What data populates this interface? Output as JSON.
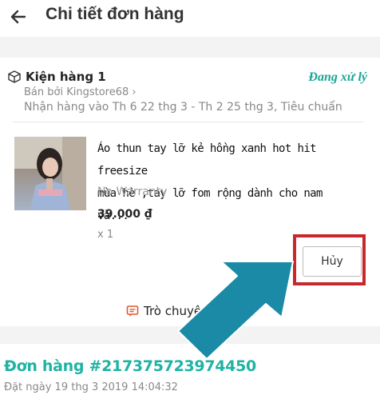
{
  "header": {
    "title": "Chi tiết đơn hàng",
    "back_icon": "arrow-left-icon"
  },
  "package": {
    "label": "Kiện hàng 1",
    "status": "Đang xử lý",
    "seller": "Bán bởi Kingstore68",
    "delivery": "Nhận hàng vào Th 6 22 thg 3 - Th 2 25 thg 3, Tiêu chuẩn"
  },
  "product": {
    "name_line1": "Áo thun tay lỡ kẻ hồng xanh hot hit freesize",
    "name_line2": "mùa hè ,tay lỡ fom rộng dành cho nam và...",
    "warranty": "No Warranty",
    "price": "39.000 ₫",
    "quantity": "x 1"
  },
  "actions": {
    "cancel_label": "Hủy",
    "chat_label": "Trò chuyện"
  },
  "order": {
    "number": "Đơn hàng #217375723974450",
    "placed": "Đặt ngày 19 thg 3 2019  14:04:32"
  },
  "colors": {
    "accent": "#1aa596",
    "highlight_border": "#c8272b",
    "annotation_arrow": "#1a8aa6"
  }
}
